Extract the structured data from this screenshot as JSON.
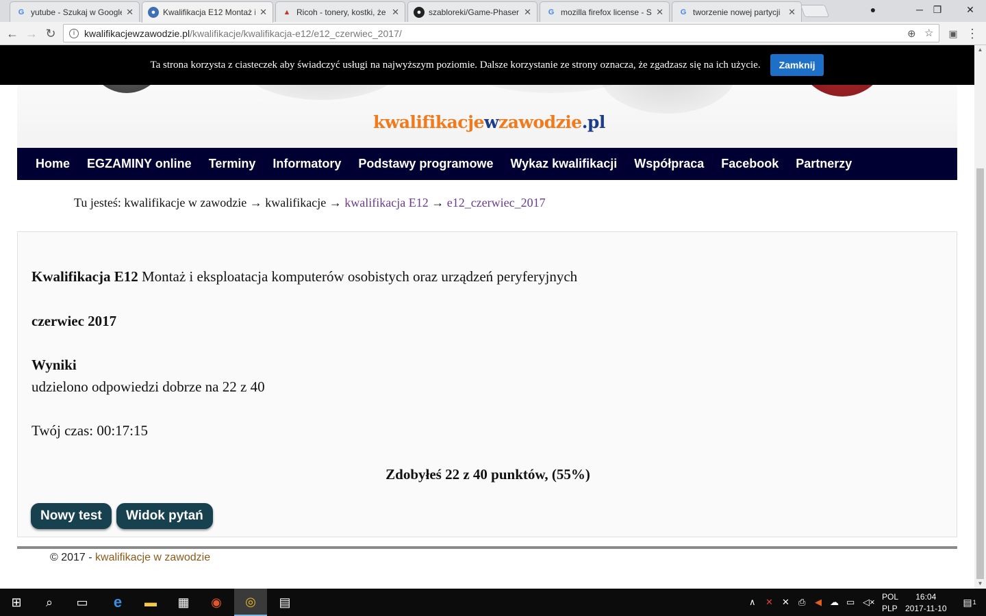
{
  "browser": {
    "tabs": [
      {
        "title": "yutube - Szukaj w Google",
        "icon": "google-icon"
      },
      {
        "title": "Kwalifikacja E12 Montaż i",
        "icon": "globe-icon"
      },
      {
        "title": "Ricoh - tonery, kostki, że",
        "icon": "ricoh-icon"
      },
      {
        "title": "szabloreki/Game-Phaser",
        "icon": "github-icon"
      },
      {
        "title": "mozilla firefox license - S",
        "icon": "google-icon"
      },
      {
        "title": "tworzenie nowej partycji",
        "icon": "google-icon"
      }
    ],
    "address": {
      "host": "kwalifikacjewzawodzie.pl",
      "path": "/kwalifikacje/kwalifikacja-e12/e12_czerwiec_2017/"
    }
  },
  "cookie_bar": {
    "text": "Ta strona korzysta z ciasteczek aby świadczyć usługi na najwyższym poziomie. Dalsze korzystanie ze strony oznacza, że zgadzasz się na ich użycie.",
    "button": "Zamknij"
  },
  "site": {
    "logo_part1": "kwalifikacje",
    "logo_part2": "w",
    "logo_part3": "zawodzie",
    "logo_part4": ".pl",
    "nav": [
      "Home",
      "EGZAMINY online",
      "Terminy",
      "Informatory",
      "Podstawy programowe",
      "Wykaz kwalifikacji",
      "Współpraca",
      "Facebook",
      "Partnerzy"
    ],
    "breadcrumb": {
      "prefix": "Tu jesteś: ",
      "item1": "kwalifikacje w zawodzie",
      "sep": " → ",
      "item2": "kwalifikacje",
      "item3": "kwalifikacja E12",
      "item4": "e12_czerwiec_2017"
    }
  },
  "result": {
    "qual_bold": "Kwalifikacja E12",
    "qual_desc": " Montaż i eksploatacja komputerów osobistych oraz urządzeń peryferyjnych",
    "session": "czerwiec 2017",
    "results_heading": "Wyniki",
    "answers_line": "udzielono odpowiedzi dobrze na 22 z 40",
    "time_line": "Twój czas: 00:17:15",
    "score_line": "Zdobyłeś 22 z 40 punktów, (55%)",
    "new_test_button": "Nowy test",
    "view_questions_button": "Widok pytań"
  },
  "footer": {
    "prefix": "© 2017 - ",
    "link": "kwalifikacje w zawodzie"
  },
  "taskbar": {
    "lang_top": "POL",
    "lang_bottom": "PLP",
    "time": "16:04",
    "date": "2017-11-10",
    "notification_count": "1"
  }
}
